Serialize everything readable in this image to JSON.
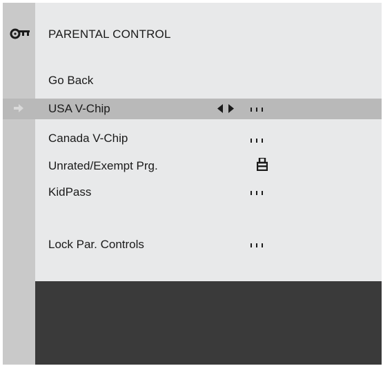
{
  "menu": {
    "title": "PARENTAL CONTROL",
    "title_icon": "key-icon",
    "items": [
      {
        "label": "Go Back"
      },
      {
        "label": "USA V-Chip",
        "selected": true,
        "value_icon": "dots-icon"
      },
      {
        "label": "Canada V-Chip",
        "value_icon": "dots-icon"
      },
      {
        "label": "Unrated/Exempt Prg.",
        "value_icon": "lock-icon"
      },
      {
        "label": "KidPass",
        "value_icon": "dots-icon"
      },
      {
        "label": "Lock Par. Controls",
        "value_icon": "dots-icon"
      }
    ]
  },
  "colors": {
    "background": "#ebebeb",
    "sidebar": "#c9c9c9",
    "selected_row": "#b9b9b9",
    "footer": "#3a3a3a",
    "text": "#1a1a1a"
  }
}
